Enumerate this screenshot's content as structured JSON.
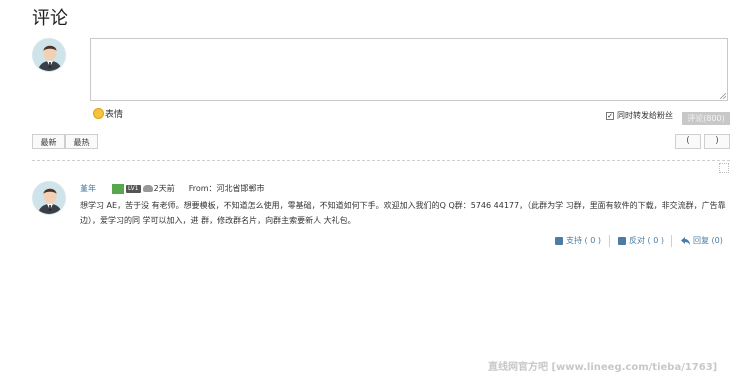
{
  "page": {
    "title": "评论"
  },
  "composer": {
    "emoji_label": "表情",
    "repost_label": "同时转发给粉丝",
    "submit_label": "评论(800)"
  },
  "sort": {
    "newest_label": "最新",
    "hottest_label": "最热"
  },
  "pagination": {
    "prev_label": "(",
    "next_label": ")"
  },
  "comment": {
    "username": "堇年",
    "badge_level": "LV1",
    "time": "2天前",
    "from": "From：河北省邯郸市",
    "text": "想学习 AE，苦于没 有老师。想要模板，不知道怎么使用，零基础，不知道如何下手。欢迎加入我们的Q Q群：5746 44177，（此群为学 习群，里面有软件的下载，非交流群，广告靠边），爱学习的同 学可以加入，进 群，修改群名片，向群主索要新人 大礼包。",
    "support_label": "支持 ( 0 )",
    "oppose_label": "反对 ( 0 )",
    "reply_label": "回复 (0)"
  },
  "watermark": "直线网官方吧 [www.lineeg.com/tieba/1763]",
  "colors": {
    "link": "#4a7ca5",
    "submit_bg": "#c8c8c8"
  }
}
